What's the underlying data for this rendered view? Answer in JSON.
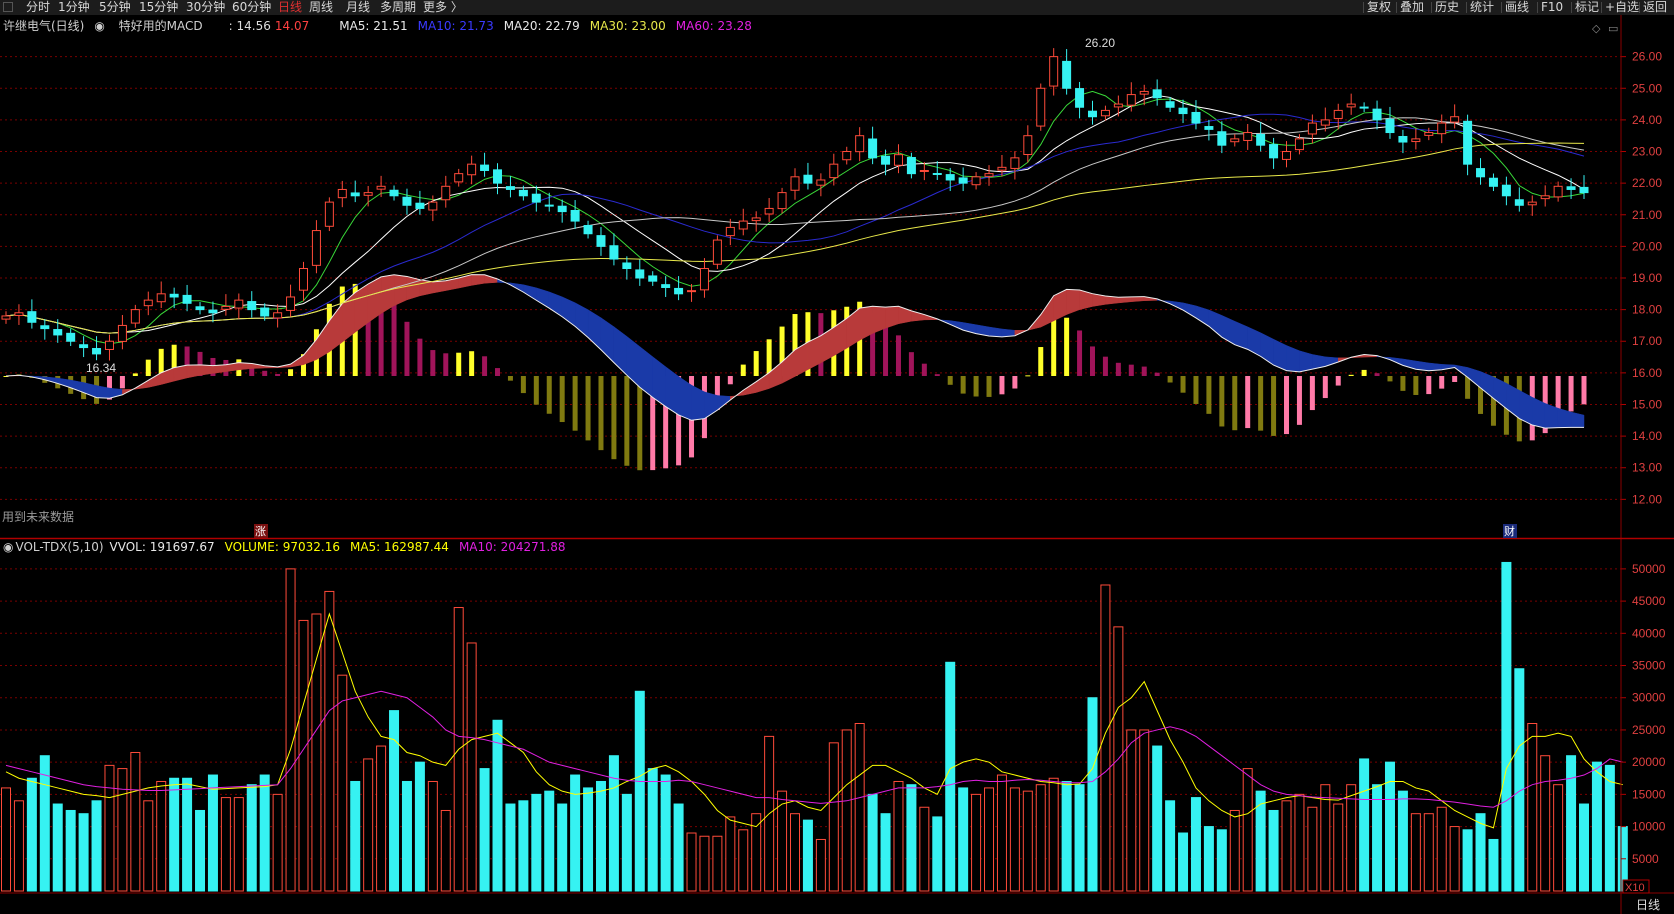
{
  "toolbar": {
    "timeframes": [
      "分时",
      "1分钟",
      "5分钟",
      "15分钟",
      "30分钟",
      "60分钟",
      "日线",
      "周线",
      "月线",
      "多周期",
      "更多 〉"
    ],
    "active_index": 6,
    "right": [
      "复权",
      "叠加",
      "历史",
      "统计",
      "画线",
      "F10",
      "标记",
      "+自选",
      "返回"
    ]
  },
  "main_legend": {
    "stock": "许继电气(日线)",
    "indicator": "特好用的MACD",
    "val1": ": 14.56",
    "val2": "14.07",
    "ma5": "MA5: 21.51",
    "ma10": "MA10: 21.73",
    "ma20": "MA20: 22.79",
    "ma30": "MA30: 23.00",
    "ma60": "MA60: 23.28"
  },
  "vol_legend": {
    "name": "VOL-TDX(5,10)",
    "vvol": "VVOL: 191697.67",
    "volume": "VOLUME: 97032.16",
    "ma5": "MA5: 162987.44",
    "ma10": "MA10: 204271.88"
  },
  "colors": {
    "up": "#ff4b3a",
    "down": "#36f2f2",
    "ma5": "#ffffff",
    "ma10": "#ffff00",
    "ma20": "#2a2acf",
    "ma30": "#e8e84a",
    "ma60": "#d814d8",
    "grid": "#7a0000"
  },
  "annotations": {
    "high": "26.20",
    "low": "16.34",
    "note": "用到未来数据",
    "marker_up": "涨",
    "marker_cai": "财",
    "x10": "X10",
    "period": "日线"
  },
  "chart_data": [
    {
      "type": "candlestick",
      "title": "许继电气(日线)",
      "y_ticks": [
        26.0,
        25.0,
        24.0,
        23.0,
        22.0,
        21.0,
        20.0,
        19.0,
        18.0,
        17.0,
        16.0,
        15.0,
        14.0,
        13.0,
        12.0
      ],
      "ylim": [
        11.6,
        26.4
      ],
      "closes": [
        17.8,
        17.9,
        17.6,
        17.4,
        17.2,
        17.0,
        16.8,
        16.6,
        17.0,
        17.5,
        18.0,
        18.3,
        18.5,
        18.4,
        18.2,
        18.0,
        17.9,
        18.1,
        18.3,
        18.0,
        17.8,
        17.9,
        18.4,
        19.3,
        20.5,
        21.4,
        21.8,
        21.6,
        21.7,
        21.9,
        21.6,
        21.3,
        21.2,
        21.4,
        21.9,
        22.3,
        22.6,
        22.4,
        22.0,
        21.8,
        21.6,
        21.4,
        21.3,
        21.1,
        20.8,
        20.4,
        20.0,
        19.6,
        19.3,
        19.0,
        18.9,
        18.7,
        18.5,
        18.6,
        19.3,
        20.2,
        20.6,
        20.8,
        20.9,
        21.2,
        21.7,
        22.2,
        22.0,
        22.1,
        22.6,
        23.0,
        23.5,
        22.8,
        22.6,
        22.9,
        22.3,
        22.4,
        22.3,
        22.1,
        22.0,
        22.2,
        22.3,
        22.5,
        22.8,
        23.5,
        25.0,
        26.0,
        25.0,
        24.4,
        24.1,
        24.3,
        24.5,
        24.8,
        24.9,
        24.7,
        24.4,
        24.2,
        23.9,
        23.7,
        23.2,
        23.4,
        23.6,
        23.2,
        22.8,
        23.0,
        23.4,
        23.9,
        24.0,
        24.3,
        24.5,
        24.4,
        24.0,
        23.6,
        23.3,
        23.4,
        23.6,
        23.9,
        24.1,
        22.6,
        22.2,
        21.9,
        21.6,
        21.3,
        21.4,
        21.6,
        21.9,
        21.8,
        21.7
      ],
      "volume_y_ticks": [
        50000,
        45000,
        40000,
        35000,
        30000,
        25000,
        20000,
        15000,
        10000,
        5000
      ],
      "volume_ylim": [
        0,
        52000
      ],
      "volume": [
        16000,
        14000,
        17500,
        21000,
        13500,
        12500,
        12000,
        14000,
        19500,
        19000,
        21500,
        14000,
        17000,
        17500,
        17500,
        12500,
        18000,
        14500,
        14500,
        16500,
        18000,
        15000,
        50000,
        42000,
        43000,
        46500,
        33500,
        17000,
        20500,
        22500,
        28000,
        17000,
        20000,
        17000,
        12500,
        44000,
        38500,
        19000,
        26500,
        13500,
        14000,
        15000,
        15500,
        13500,
        18000,
        16000,
        17000,
        21000,
        15000,
        31000,
        19000,
        18000,
        13500,
        9000,
        8500,
        8500,
        11500,
        9500,
        12000,
        24000,
        15500,
        12000,
        11000,
        8000,
        23000,
        25000,
        26000,
        15000,
        12000,
        17000,
        16500,
        13000,
        11500,
        35500,
        16000,
        15000,
        16000,
        18000,
        16000,
        15500,
        16500,
        17500,
        17000,
        16500,
        30000,
        47500,
        41000,
        25000,
        25000,
        22500,
        14000,
        9000,
        14500,
        10000,
        9500,
        12500,
        19000,
        15500,
        12500,
        14000,
        15000,
        13000,
        16500,
        13500,
        16500,
        20500,
        16500,
        20000,
        15500,
        12000,
        12000,
        13000,
        10000,
        9500,
        12000,
        8000,
        51000,
        34500,
        26000,
        21000,
        16500,
        21000,
        13500,
        20000,
        19500,
        10000
      ],
      "volume_ma5": [
        18500,
        17500,
        17000,
        16500,
        16000,
        15500,
        15000,
        14800,
        14500,
        15000,
        15500,
        16000,
        16300,
        16500,
        16600,
        16200,
        15800,
        15900,
        16000,
        16100,
        16200,
        16500,
        22000,
        29000,
        36000,
        43000,
        37000,
        31000,
        27000,
        24000,
        23500,
        21500,
        21000,
        20000,
        19500,
        22000,
        23500,
        24000,
        24500,
        23000,
        21500,
        18500,
        16500,
        15500,
        15000,
        15200,
        15500,
        16000,
        17000,
        17800,
        19000,
        19500,
        18500,
        17000,
        15000,
        12500,
        11000,
        10500,
        10000,
        12000,
        13500,
        14000,
        13000,
        12500,
        14500,
        16500,
        18000,
        19500,
        19500,
        18500,
        17500,
        16000,
        15000,
        19000,
        20000,
        20500,
        20000,
        18500,
        18000,
        17500,
        17000,
        16800,
        16500,
        16600,
        19000,
        24500,
        28500,
        30000,
        32500,
        28000,
        23500,
        20000,
        16000,
        14000,
        12500,
        11500,
        12000,
        13500,
        14000,
        14500,
        14800,
        14500,
        14200,
        14100,
        14800,
        15500,
        16200,
        17000,
        17000,
        16000,
        15500,
        14000,
        12500,
        11500,
        10500,
        9800,
        19000,
        22500,
        24000,
        24000,
        24500,
        24000,
        20500,
        18500,
        17000,
        16500
      ],
      "volume_ma10": [
        19500,
        19000,
        18500,
        18000,
        17500,
        17000,
        16500,
        16200,
        16000,
        15800,
        15700,
        15600,
        15600,
        15700,
        15800,
        15900,
        16000,
        16100,
        16200,
        16300,
        16400,
        16500,
        19000,
        22000,
        25000,
        28000,
        29500,
        30000,
        30500,
        31000,
        30500,
        30000,
        28500,
        27000,
        25000,
        24000,
        23800,
        23500,
        23000,
        22500,
        22000,
        21000,
        20000,
        19500,
        19000,
        18500,
        18000,
        17500,
        17200,
        17000,
        17000,
        17000,
        17200,
        17000,
        16500,
        16000,
        15500,
        15000,
        14500,
        14500,
        14200,
        14000,
        13800,
        13600,
        13800,
        14000,
        14500,
        15000,
        15500,
        16000,
        16000,
        16000,
        16200,
        16500,
        17000,
        17200,
        17000,
        17000,
        17200,
        17300,
        17200,
        17000,
        16800,
        16800,
        17000,
        18500,
        20500,
        23000,
        24500,
        25000,
        25500,
        25000,
        24000,
        22500,
        21000,
        19500,
        18000,
        16500,
        15500,
        15000,
        14800,
        14600,
        14500,
        14400,
        14300,
        14200,
        14200,
        14200,
        14300,
        14300,
        14200,
        14000,
        13800,
        13500,
        13200,
        13000,
        14000,
        15500,
        16500,
        17000,
        17200,
        17500,
        18000,
        19000,
        20500,
        20000
      ]
    }
  ]
}
